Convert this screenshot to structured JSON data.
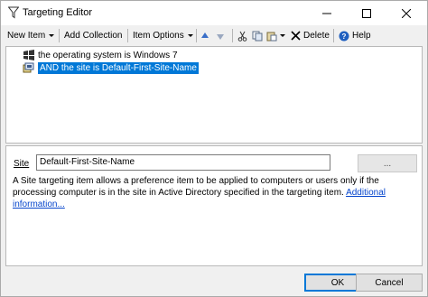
{
  "window": {
    "title": "Targeting Editor"
  },
  "toolbar": {
    "new_item": "New Item",
    "add_collection": "Add Collection",
    "item_options": "Item Options",
    "delete": "Delete",
    "help": "Help"
  },
  "tree": {
    "items": [
      {
        "label": "the operating system is Windows 7",
        "icon": "os-icon",
        "selected": false
      },
      {
        "label": "AND the site is Default-First-Site-Name",
        "icon": "site-icon",
        "selected": true
      }
    ]
  },
  "details": {
    "site_label": "Site",
    "site_value": "Default-First-Site-Name",
    "browse_label": "...",
    "description": "A Site targeting item allows a preference item to be applied to computers or users only if the processing computer is in the site in Active Directory specified in the targeting item.",
    "more_info_link": "Additional information..."
  },
  "footer": {
    "ok": "OK",
    "cancel": "Cancel"
  },
  "colors": {
    "selection": "#0078d7",
    "link": "#0645cc",
    "delete_icon": "#000000",
    "help_icon": "#1f5fbf"
  }
}
